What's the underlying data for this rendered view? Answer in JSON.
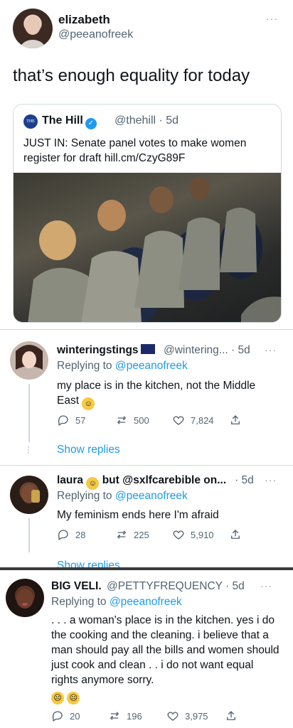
{
  "main_tweet": {
    "name": "elizabeth",
    "handle": "@peeanofreek",
    "text": "that’s enough equality for today",
    "more": "···",
    "quote": {
      "logo_text": "THE HILL",
      "name": "The Hill",
      "handle": "@thehill · 5d",
      "text": "JUST IN: Senate panel votes to make women register for draft hill.cm/CzyG89F"
    }
  },
  "replies": [
    {
      "name": "winteringstings",
      "handle": "@wintering... · 5d",
      "replying_prefix": "Replying to ",
      "replying_to": "@peeanofreek",
      "text": "my place is in the kitchen, not the Middle East",
      "emoji": "☺",
      "reply_count": "57",
      "retweet_count": "500",
      "like_count": "7,824",
      "show_replies": "Show replies"
    },
    {
      "name": "laura",
      "name_suffix": "but @sxlfcarebible on...",
      "handle": "· 5d",
      "replying_prefix": "Replying to ",
      "replying_to": "@peeanofreek",
      "text": "My feminism ends here I'm afraid",
      "reply_count": "28",
      "retweet_count": "225",
      "like_count": "5,910",
      "show_replies": "Show replies"
    },
    {
      "name": "BIG VELI.",
      "handle": "@PETTYFREQUENCY · 5d",
      "replying_prefix": "Replying to ",
      "replying_to": "@peeanofreek",
      "text": ". . . a woman's place is in the kitchen. yes i do the cooking and the cleaning. i believe that a man should pay all the bills and women should just cook and clean . . i do not want equal rights anymore sorry.",
      "reply_count": "20",
      "retweet_count": "196",
      "like_count": "3,975"
    }
  ],
  "colors": {
    "link_blue": "#1d9bf0",
    "secondary_text": "#536471",
    "border": "#cfd9de"
  }
}
